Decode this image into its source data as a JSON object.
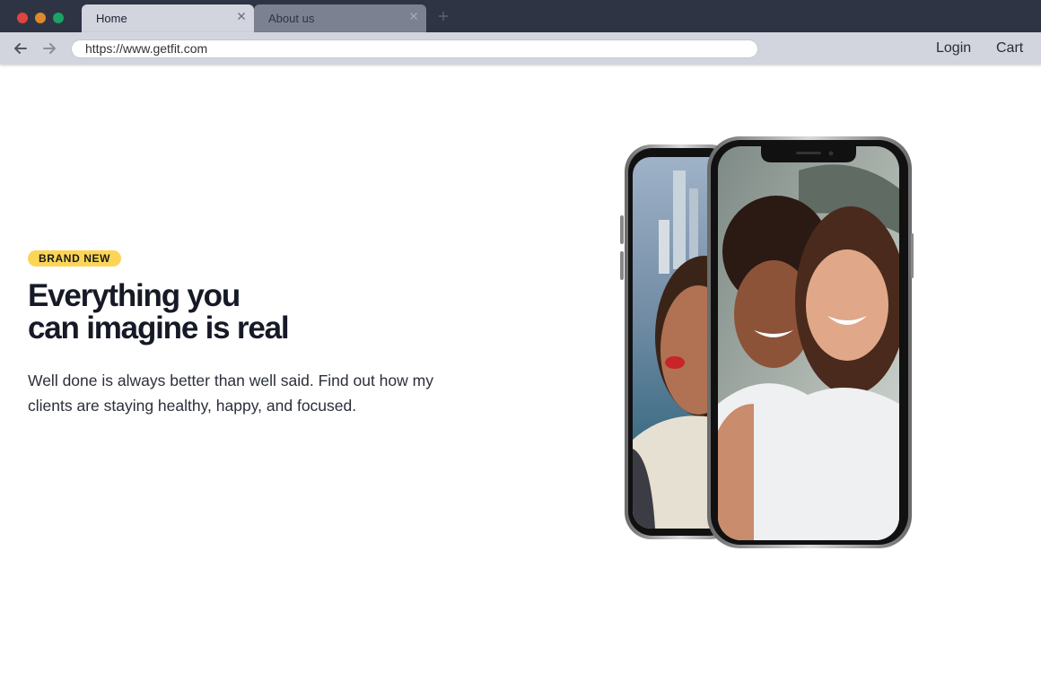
{
  "browser": {
    "tabs": [
      {
        "label": "Home",
        "active": true
      },
      {
        "label": "About us",
        "active": false
      }
    ],
    "address_url": "https://www.getfit.com",
    "nav_links": {
      "login": "Login",
      "cart": "Cart"
    },
    "icons": {
      "back": "arrow-left-icon",
      "forward": "arrow-right-icon",
      "close": "close-icon",
      "new_tab": "plus-icon"
    },
    "colors": {
      "titlebar": "#2e3444",
      "toolbar": "#d2d5dd",
      "traffic_close": "#e0443e",
      "traffic_minimize": "#de8a2c",
      "traffic_zoom": "#1aa364"
    }
  },
  "hero": {
    "badge": "BRAND NEW",
    "headline_line1": "Everything you",
    "headline_line2": "can imagine is real",
    "lead": "Well done is always better than well said. Find out how my clients are staying healthy, happy, and focused.",
    "image": "two smartphones showing selfie of smiling women",
    "colors": {
      "badge_bg": "#fcd556",
      "headline": "#161a26"
    }
  }
}
